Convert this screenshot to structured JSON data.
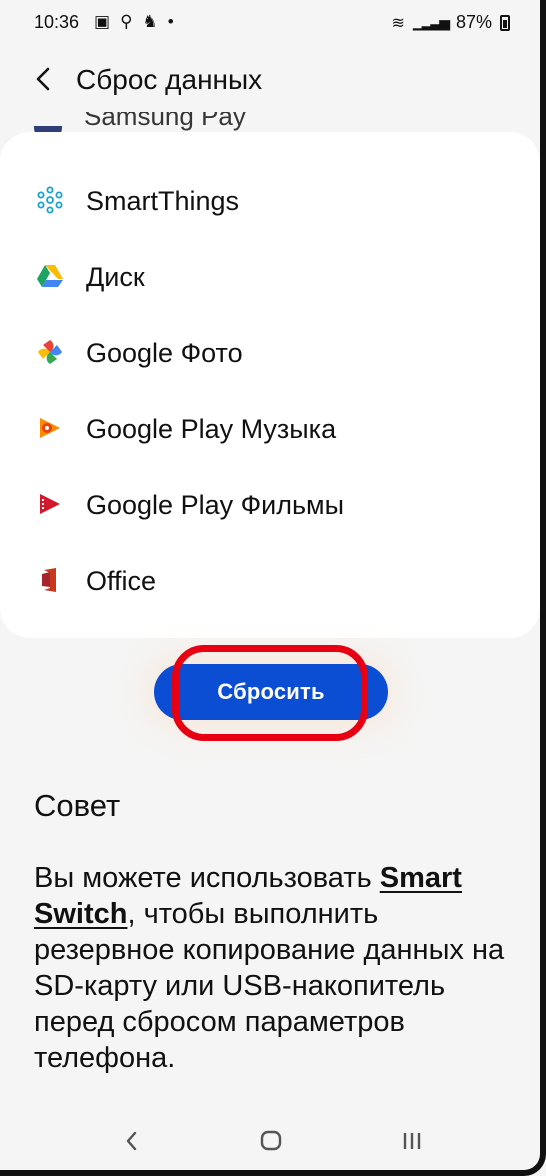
{
  "status_bar": {
    "time": "10:36",
    "battery": "87%"
  },
  "header": {
    "title": "Сброс данных"
  },
  "apps": {
    "partial_item": "Samsung Pay",
    "items": [
      {
        "label": "SmartThings",
        "icon": "smartthings-icon"
      },
      {
        "label": "Диск",
        "icon": "google-drive-icon"
      },
      {
        "label": "Google Фото",
        "icon": "google-photos-icon"
      },
      {
        "label": "Google Play Музыка",
        "icon": "google-play-music-icon"
      },
      {
        "label": "Google Play Фильмы",
        "icon": "google-play-movies-icon"
      },
      {
        "label": "Office",
        "icon": "office-icon"
      }
    ]
  },
  "reset_button": {
    "label": "Сбросить"
  },
  "tip": {
    "title": "Совет",
    "text_before": "Вы можете использовать ",
    "link": "Smart Switch",
    "text_after": ", чтобы выполнить резервное копирование данных на SD-карту или USB-накопитель перед сбросом параметров телефона."
  },
  "colors": {
    "accent_blue": "#0b4ed3",
    "highlight_red": "#e60012"
  }
}
